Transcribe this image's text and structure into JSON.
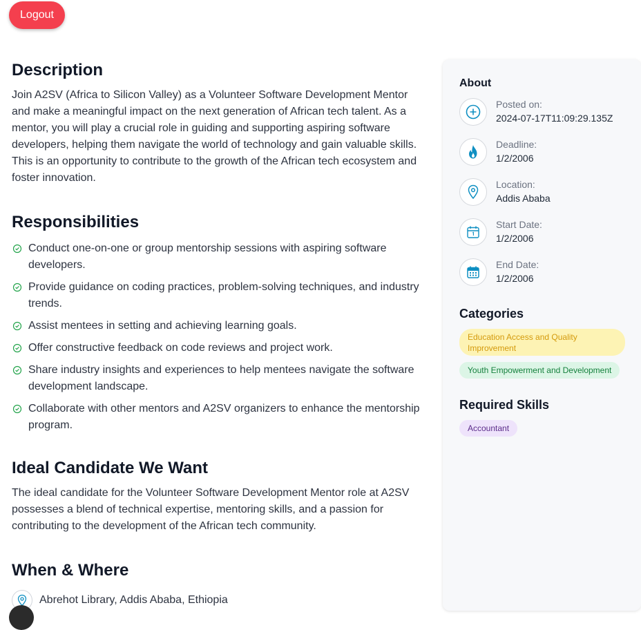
{
  "header": {
    "logout_label": "Logout"
  },
  "description": {
    "title": "Description",
    "text": "Join A2SV (Africa to Silicon Valley) as a Volunteer Software Development Mentor and make a meaningful impact on the next generation of African tech talent. As a mentor, you will play a crucial role in guiding and supporting aspiring software developers, helping them navigate the world of technology and gain valuable skills. This is an opportunity to contribute to the growth of the African tech ecosystem and foster innovation."
  },
  "responsibilities": {
    "title": "Responsibilities",
    "items": [
      "Conduct one-on-one or group mentorship sessions with aspiring software developers.",
      "Provide guidance on coding practices, problem-solving techniques, and industry trends.",
      "Assist mentees in setting and achieving learning goals.",
      "Offer constructive feedback on code reviews and project work.",
      "Share industry insights and experiences to help mentees navigate the software development landscape.",
      "Collaborate with other mentors and A2SV organizers to enhance the mentorship program."
    ]
  },
  "ideal_candidate": {
    "title": "Ideal Candidate We Want",
    "text": "The ideal candidate for the Volunteer Software Development Mentor role at A2SV possesses a blend of technical expertise, mentoring skills, and a passion for contributing to the development of the African tech community."
  },
  "when_where": {
    "title": "When & Where",
    "location": "Abrehot Library, Addis Ababa, Ethiopia"
  },
  "about": {
    "title": "About",
    "items": [
      {
        "label": "Posted on:",
        "value": "2024-07-17T11:09:29.135Z",
        "icon": "plus-circle-icon"
      },
      {
        "label": "Deadline:",
        "value": "1/2/2006",
        "icon": "fire-icon"
      },
      {
        "label": "Location:",
        "value": "Addis Ababa",
        "icon": "location-pin-icon"
      },
      {
        "label": "Start Date:",
        "value": "1/2/2006",
        "icon": "calendar-start-icon"
      },
      {
        "label": "End Date:",
        "value": "1/2/2006",
        "icon": "calendar-end-icon"
      }
    ]
  },
  "categories": {
    "title": "Categories",
    "items": [
      {
        "label": "Education Access and Quality Improvement",
        "color": "#d49a0c",
        "bg": "#fdf3b4"
      },
      {
        "label": "Youth Empowerment and Development",
        "color": "#15803d",
        "bg": "#dcf5e6"
      }
    ]
  },
  "skills": {
    "title": "Required Skills",
    "items": [
      {
        "label": "Accountant",
        "color": "#5b2c8a",
        "bg": "#eee3fb"
      }
    ]
  },
  "colors": {
    "accent": "#0e8fc2",
    "logout": "#f43f4e",
    "check": "#22a34a"
  }
}
